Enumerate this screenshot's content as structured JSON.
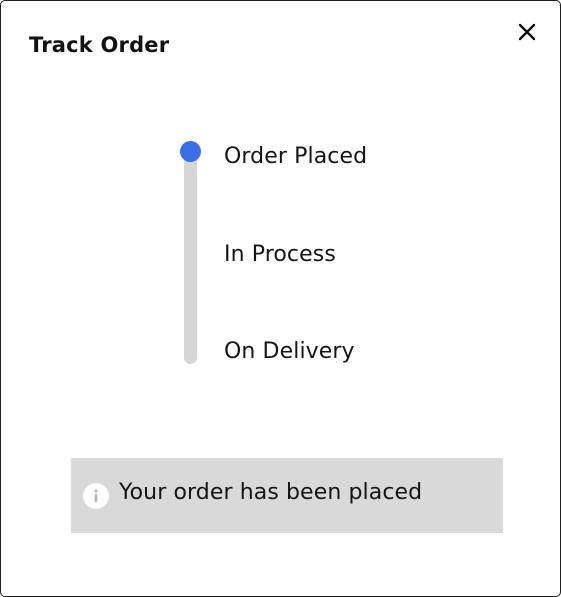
{
  "dialog": {
    "title": "Track Order",
    "close_icon": "close-icon"
  },
  "tracker": {
    "active_color": "#3a6ee8",
    "track_color": "#d6d6d6",
    "current_step_index": 0,
    "steps": [
      {
        "label": "Order Placed"
      },
      {
        "label": "In Process"
      },
      {
        "label": "On Delivery"
      }
    ]
  },
  "notice": {
    "icon": "info-icon",
    "message": "Your order has been placed",
    "background": "#d9d9d9"
  }
}
